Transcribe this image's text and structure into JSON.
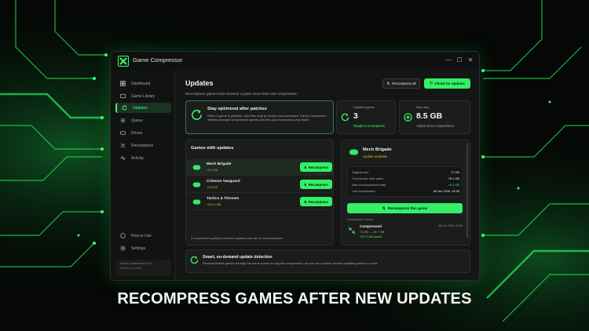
{
  "colors": {
    "accent": "#33f066",
    "warning": "#d6b520",
    "background": "#050806",
    "panel": "#1b1d1c"
  },
  "window": {
    "title": "Game Compressor",
    "controls": [
      "—",
      "☐",
      "✕"
    ]
  },
  "sidebar": {
    "items": [
      {
        "label": "Dashboard",
        "icon": "dashboard-icon"
      },
      {
        "label": "Game Library",
        "icon": "library-icon"
      },
      {
        "label": "Updates",
        "icon": "refresh-icon",
        "active": true
      },
      {
        "label": "Queue",
        "icon": "queue-icon"
      },
      {
        "label": "Drives",
        "icon": "drive-icon"
      },
      {
        "label": "Decompress",
        "icon": "decompress-icon"
      },
      {
        "label": "Activity",
        "icon": "activity-icon"
      }
    ],
    "bottom_items": [
      {
        "label": "How to Use",
        "icon": "help-icon"
      },
      {
        "label": "Settings",
        "icon": "gear-icon"
      }
    ],
    "version": {
      "line1": "Game Compressor v0.9.5",
      "line2": "Ready • Up to date"
    }
  },
  "header": {
    "title": "Updates",
    "subtitle": "Recompress games that received a patch since their last compression",
    "recompress_all": "Recompress all",
    "check_updates": "Check for updates"
  },
  "info_card": {
    "title": "Stay optimized after patches",
    "description": "When a game is patched, new files may be stored uncompressed. Game Compressor detects changed compressed games and lets you recompress only those."
  },
  "stats": {
    "updated": {
      "label": "Updated games",
      "value": "3",
      "note": "Ready to recompress"
    },
    "new_data": {
      "label": "New data",
      "value": "8.5 GB",
      "note": "Added since compression"
    }
  },
  "games_list": {
    "title": "Games with updates",
    "button_label": "Recompress",
    "rows": [
      {
        "name": "Mech Brigade",
        "size": "+5.1 GB"
      },
      {
        "name": "Crimson Vanguard",
        "size": "+2.8 GB"
      },
      {
        "name": "Tactics & Thrones",
        "size": "+614.4 MB"
      }
    ],
    "footer": "3 compressed game(s) received updates and can be recompressed."
  },
  "detail": {
    "name": "Mech Brigade",
    "status": "Update available",
    "rows": [
      {
        "label": "Original size",
        "value": "71 GB"
      },
      {
        "label": "Current size after patch",
        "value": "76.1 GB"
      },
      {
        "label": "New uncompressed data",
        "value": "+5.1 GB"
      },
      {
        "label": "Last compressed",
        "value": "08 Jun 2026, 18:35"
      }
    ],
    "button": "Recompress this game",
    "history_label": "Compression history",
    "history": {
      "title": "Compressed",
      "sizes": "71 GB → 49.7 GB",
      "saved": "+21.3 GB saved",
      "date": "08 Jun 2026, 18:35"
    }
  },
  "bottom_card": {
    "title": "Smart, on-demand update detection",
    "description": "Recompressive games through the same queue as regular compression, so you can process several updated games in a row."
  },
  "banner": "RECOMPRESS GAMES AFTER NEW UPDATES"
}
